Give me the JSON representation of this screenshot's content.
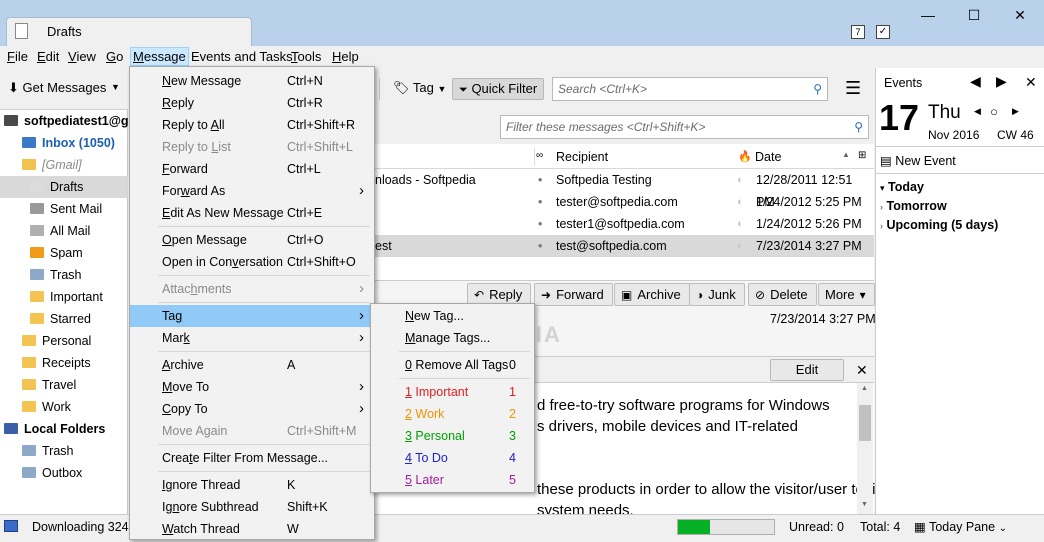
{
  "window": {
    "tab_title": "Drafts",
    "minimize": "—",
    "maximize": "☐",
    "close": "✕"
  },
  "menubar": [
    "File",
    "Edit",
    "View",
    "Go",
    "Message",
    "Events and Tasks",
    "Tools",
    "Help"
  ],
  "toolbar": {
    "get_messages": "Get Messages",
    "tag": "Tag",
    "quick_filter": "Quick Filter",
    "search_placeholder": "Search <Ctrl+K>",
    "filter_placeholder": "Filter these messages <Ctrl+Shift+K>"
  },
  "folders": [
    {
      "label": "softpediatest1@g",
      "type": "account"
    },
    {
      "label": "Inbox (1050)",
      "type": "inbox"
    },
    {
      "label": "[Gmail]",
      "type": "gmail"
    },
    {
      "label": "Drafts",
      "type": "drafts"
    },
    {
      "label": "Sent Mail",
      "type": "sent"
    },
    {
      "label": "All Mail",
      "type": "all"
    },
    {
      "label": "Spam",
      "type": "spam"
    },
    {
      "label": "Trash",
      "type": "trash"
    },
    {
      "label": "Important",
      "type": "folder"
    },
    {
      "label": "Starred",
      "type": "folder"
    },
    {
      "label": "Personal",
      "type": "folder"
    },
    {
      "label": "Receipts",
      "type": "folder"
    },
    {
      "label": "Travel",
      "type": "folder"
    },
    {
      "label": "Work",
      "type": "folder"
    },
    {
      "label": "Local Folders",
      "type": "local"
    },
    {
      "label": "Trash",
      "type": "trash"
    },
    {
      "label": "Outbox",
      "type": "outbox"
    }
  ],
  "columns": {
    "recipient": "Recipient",
    "date": "Date"
  },
  "messages": [
    {
      "subject": "nloads - Softpedia",
      "recipient": "Softpedia Testing",
      "date": "12/28/2011 12:51 PM"
    },
    {
      "subject": "",
      "recipient": "tester@softpedia.com",
      "date": "1/24/2012 5:25 PM"
    },
    {
      "subject": "",
      "recipient": "tester1@softpedia.com",
      "date": "1/24/2012 5:26 PM"
    },
    {
      "subject": "est",
      "recipient": "test@softpedia.com",
      "date": "7/23/2014 3:27 PM"
    }
  ],
  "header_buttons": [
    "Reply",
    "Forward",
    "Archive",
    "Junk",
    "Delete",
    "More"
  ],
  "header_date": "7/23/2014 3:27 PM",
  "edit_button": "Edit",
  "body_lines": [
    "d free-to-try software programs for Windows",
    "s drivers, mobile devices and IT-related",
    "these products in order to allow the visitor/user to find the exact",
    "system needs."
  ],
  "events": {
    "title": "Events",
    "day": "17",
    "weekday": "Thu",
    "month_year": "Nov 2016",
    "cw": "CW 46",
    "new_event": "New Event",
    "groups": [
      "Today",
      "Tomorrow",
      "Upcoming (5 days)"
    ]
  },
  "status": {
    "downloading": "Downloading 324",
    "unread": "Unread: 0",
    "total": "Total: 4",
    "today_pane": "Today Pane",
    "progress": 0.33
  },
  "message_menu": [
    {
      "label": "New Message",
      "ul": "N",
      "shortcut": "Ctrl+N"
    },
    {
      "label": "Reply",
      "ul": "R",
      "shortcut": "Ctrl+R"
    },
    {
      "label": "Reply to All",
      "ul": "A",
      "shortcut": "Ctrl+Shift+R"
    },
    {
      "label": "Reply to List",
      "ul": "L",
      "shortcut": "Ctrl+Shift+L",
      "disabled": true
    },
    {
      "label": "Forward",
      "ul": "F",
      "shortcut": "Ctrl+L"
    },
    {
      "label": "Forward As",
      "ul": "w",
      "submenu": true
    },
    {
      "label": "Edit As New Message",
      "ul": "E",
      "shortcut": "Ctrl+E"
    },
    {
      "sep": true
    },
    {
      "label": "Open Message",
      "ul": "O",
      "shortcut": "Ctrl+O"
    },
    {
      "label": "Open in Conversation",
      "ul": "v",
      "shortcut": "Ctrl+Shift+O"
    },
    {
      "sep": true
    },
    {
      "label": "Attachments",
      "ul": "h",
      "disabled": true,
      "submenu": true
    },
    {
      "sep": true
    },
    {
      "label": "Tag",
      "ul": "g",
      "submenu": true,
      "highlight": true
    },
    {
      "label": "Mark",
      "ul": "k",
      "submenu": true
    },
    {
      "sep": true
    },
    {
      "label": "Archive",
      "ul": "A",
      "shortcut": "A"
    },
    {
      "label": "Move To",
      "ul": "M",
      "submenu": true
    },
    {
      "label": "Copy To",
      "ul": "C",
      "submenu": true
    },
    {
      "label": "Move Again",
      "ul": "g",
      "shortcut": "Ctrl+Shift+M",
      "disabled": true
    },
    {
      "sep": true
    },
    {
      "label": "Create Filter From Message...",
      "ul": "t"
    },
    {
      "sep": true
    },
    {
      "label": "Ignore Thread",
      "ul": "I",
      "shortcut": "K"
    },
    {
      "label": "Ignore Subthread",
      "ul": "n",
      "shortcut": "Shift+K"
    },
    {
      "label": "Watch Thread",
      "ul": "W",
      "shortcut": "W"
    }
  ],
  "tag_menu": [
    {
      "label": "New Tag...",
      "ul": "N"
    },
    {
      "label": "Manage Tags...",
      "ul": "M"
    },
    {
      "sep": true
    },
    {
      "label": "0 Remove All Tags",
      "ul": "0",
      "shortcut": "0"
    },
    {
      "sep": true
    },
    {
      "label": "1 Important",
      "ul": "1",
      "shortcut": "1",
      "color": "#e02020"
    },
    {
      "label": "2 Work",
      "ul": "2",
      "shortcut": "2",
      "color": "#f39200"
    },
    {
      "label": "3 Personal",
      "ul": "3",
      "shortcut": "3",
      "color": "#00a000"
    },
    {
      "label": "4 To Do",
      "ul": "4",
      "shortcut": "4",
      "color": "#2020d0"
    },
    {
      "label": "5 Later",
      "ul": "5",
      "shortcut": "5",
      "color": "#a020a0"
    }
  ],
  "watermark": "SOFTPEDIA"
}
